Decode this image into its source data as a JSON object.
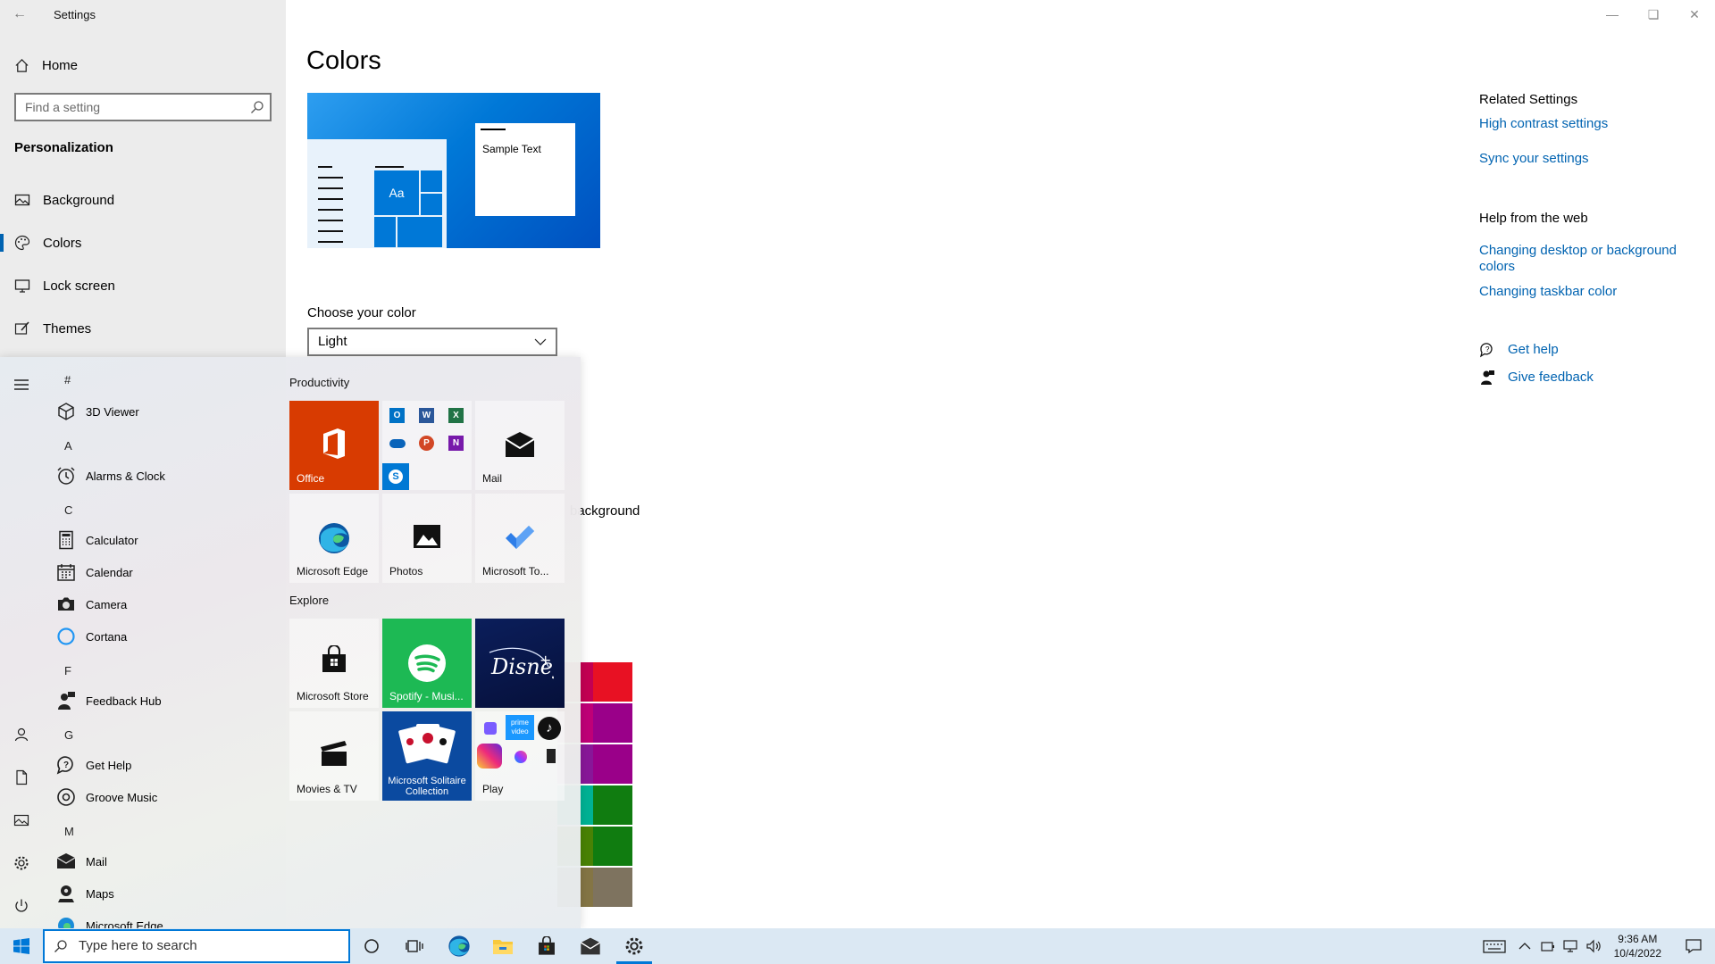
{
  "window": {
    "title": "Settings"
  },
  "sidebar": {
    "home_label": "Home",
    "search_placeholder": "Find a setting",
    "section": "Personalization",
    "items": [
      {
        "label": "Background",
        "icon": "picture-icon"
      },
      {
        "label": "Colors",
        "icon": "palette-icon",
        "selected": true
      },
      {
        "label": "Lock screen",
        "icon": "monitor-icon"
      },
      {
        "label": "Themes",
        "icon": "brush-icon"
      }
    ]
  },
  "main": {
    "title": "Colors",
    "preview_text": "Sample Text",
    "preview_tile_text": "Aa",
    "choose_color_label": "Choose your color",
    "choose_color_value": "Light",
    "partial_text": "background",
    "accent_colors": [
      "#c30052",
      "#e81123",
      "#bf0077",
      "#9a0089",
      "#881798",
      "#9a0089",
      "#00b294",
      "#107c10",
      "#498205",
      "#107c10",
      "#847545",
      "#7e735f"
    ]
  },
  "related": {
    "heading": "Related Settings",
    "links": [
      "High contrast settings",
      "Sync your settings"
    ],
    "web_heading": "Help from the web",
    "web_links": [
      "Changing desktop or background colors",
      "Changing taskbar color"
    ],
    "get_help": "Get help",
    "give_feedback": "Give feedback"
  },
  "start_menu": {
    "apps": [
      {
        "type": "letter",
        "text": "#"
      },
      {
        "type": "app",
        "text": "3D Viewer",
        "icon": "cube-icon"
      },
      {
        "type": "letter",
        "text": "A"
      },
      {
        "type": "app",
        "text": "Alarms & Clock",
        "icon": "alarm-clock-icon"
      },
      {
        "type": "letter",
        "text": "C"
      },
      {
        "type": "app",
        "text": "Calculator",
        "icon": "calculator-icon"
      },
      {
        "type": "app",
        "text": "Calendar",
        "icon": "calendar-icon"
      },
      {
        "type": "app",
        "text": "Camera",
        "icon": "camera-icon"
      },
      {
        "type": "app",
        "text": "Cortana",
        "icon": "cortana-icon"
      },
      {
        "type": "letter",
        "text": "F"
      },
      {
        "type": "app",
        "text": "Feedback Hub",
        "icon": "feedback-icon"
      },
      {
        "type": "letter",
        "text": "G"
      },
      {
        "type": "app",
        "text": "Get Help",
        "icon": "help-icon"
      },
      {
        "type": "app",
        "text": "Groove Music",
        "icon": "music-icon"
      },
      {
        "type": "letter",
        "text": "M"
      },
      {
        "type": "app",
        "text": "Mail",
        "icon": "mail-icon"
      },
      {
        "type": "app",
        "text": "Maps",
        "icon": "map-pin-icon"
      },
      {
        "type": "app",
        "text": "Microsoft Edge",
        "icon": "edge-icon"
      }
    ],
    "groups": {
      "productivity": "Productivity",
      "explore": "Explore"
    },
    "tiles": {
      "office": "Office",
      "mail": "Mail",
      "edge": "Microsoft Edge",
      "photos": "Photos",
      "todo": "Microsoft To...",
      "store": "Microsoft Store",
      "spotify": "Spotify - Musi...",
      "movies": "Movies & TV",
      "solitaire": "Microsoft Solitaire Collection",
      "play": "Play"
    }
  },
  "taskbar": {
    "search_placeholder": "Type here to search",
    "time": "9:36 AM",
    "date": "10/4/2022"
  }
}
